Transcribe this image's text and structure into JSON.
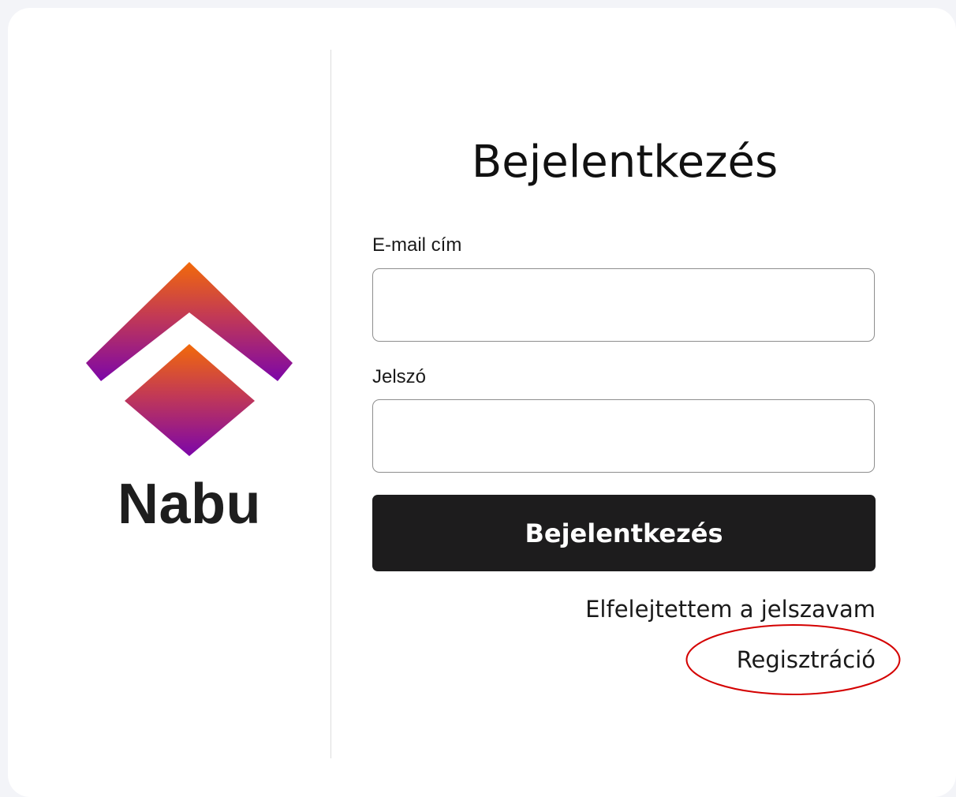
{
  "brand": {
    "name": "Nabu",
    "logo": "nabu-chevron-diamond-logo",
    "gradient_colors": [
      "#f26a0a",
      "#7c06a9"
    ]
  },
  "form": {
    "title": "Bejelentkezés",
    "email_label": "E-mail cím",
    "email_value": "",
    "password_label": "Jelszó",
    "password_value": "",
    "submit_label": "Bejelentkezés",
    "forgot_password_link": "Elfelejtettem a jelszavam",
    "register_link": "Regisztráció"
  },
  "annotation": {
    "type": "red-ellipse-highlight",
    "target": "register_link",
    "color": "#d40000"
  }
}
